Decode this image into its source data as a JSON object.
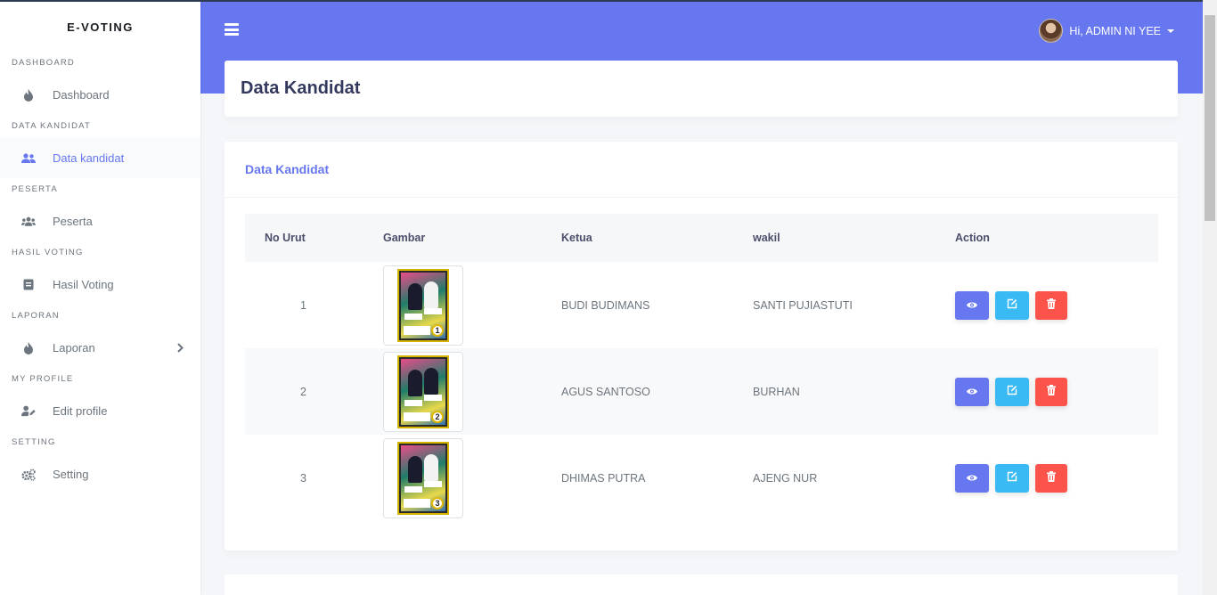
{
  "app": {
    "brand": "E-VOTING"
  },
  "sidebar": {
    "sections": [
      {
        "header": "DASHBOARD",
        "item": {
          "label": "Dashboard",
          "icon": "fire-icon"
        }
      },
      {
        "header": "DATA KANDIDAT",
        "item": {
          "label": "Data kandidat",
          "icon": "users-icon",
          "active": true
        }
      },
      {
        "header": "PESERTA",
        "item": {
          "label": "Peserta",
          "icon": "group-icon"
        }
      },
      {
        "header": "HASIL VOTING",
        "item": {
          "label": "Hasil Voting",
          "icon": "document-icon"
        }
      },
      {
        "header": "LAPORAN",
        "item": {
          "label": "Laporan",
          "icon": "fire-icon",
          "has_submenu": true
        }
      },
      {
        "header": "MY PROFILE",
        "item": {
          "label": "Edit profile",
          "icon": "user-edit-icon"
        }
      },
      {
        "header": "SETTING",
        "item": {
          "label": "Setting",
          "icon": "cogs-icon"
        }
      }
    ]
  },
  "navbar": {
    "user_greeting": "Hi, ADMIN NI YEE"
  },
  "page": {
    "title": "Data Kandidat"
  },
  "card": {
    "title": "Data Kandidat",
    "columns": [
      "No Urut",
      "Gambar",
      "Ketua",
      "wakil",
      "Action"
    ],
    "rows": [
      {
        "no": "1",
        "ketua": "BUDI BUDIMANS",
        "wakil": "SANTI PUJIASTUTI",
        "badge": "1"
      },
      {
        "no": "2",
        "ketua": "AGUS SANTOSO",
        "wakil": "BURHAN",
        "badge": "2"
      },
      {
        "no": "3",
        "ketua": "DHIMAS PUTRA",
        "wakil": "AJENG NUR",
        "badge": "3"
      }
    ]
  },
  "colors": {
    "primary": "#6777ef",
    "info": "#3abaf4",
    "danger": "#fc544b",
    "background": "#f4f6f9"
  }
}
